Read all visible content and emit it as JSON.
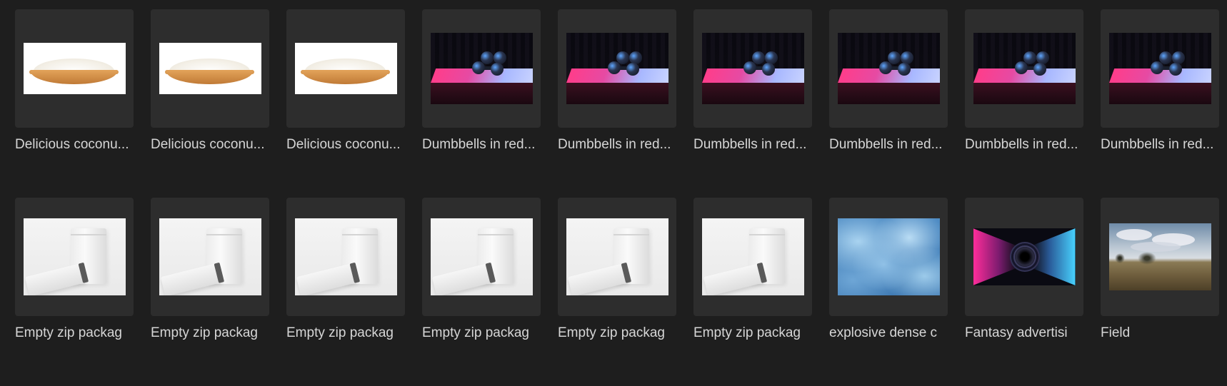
{
  "gallery": {
    "items": [
      {
        "label": "Delicious coconu...",
        "thumb": "coconut-pie"
      },
      {
        "label": "Delicious coconu...",
        "thumb": "coconut-pie"
      },
      {
        "label": "Delicious coconu...",
        "thumb": "coconut-pie"
      },
      {
        "label": "Dumbbells in red...",
        "thumb": "dumbbells"
      },
      {
        "label": "Dumbbells in red...",
        "thumb": "dumbbells"
      },
      {
        "label": "Dumbbells in red...",
        "thumb": "dumbbells"
      },
      {
        "label": "Dumbbells in red...",
        "thumb": "dumbbells"
      },
      {
        "label": "Dumbbells in red...",
        "thumb": "dumbbells"
      },
      {
        "label": "Dumbbells in red...",
        "thumb": "dumbbells"
      },
      {
        "label": "Empty zip packag",
        "thumb": "zip-package"
      },
      {
        "label": "Empty zip packag",
        "thumb": "zip-package"
      },
      {
        "label": "Empty zip packag",
        "thumb": "zip-package"
      },
      {
        "label": "Empty zip packag",
        "thumb": "zip-package"
      },
      {
        "label": "Empty zip packag",
        "thumb": "zip-package"
      },
      {
        "label": "Empty zip packag",
        "thumb": "zip-package"
      },
      {
        "label": "explosive dense c",
        "thumb": "clouds"
      },
      {
        "label": "Fantasy advertisi",
        "thumb": "neon-tunnel"
      },
      {
        "label": "Field",
        "thumb": "field"
      }
    ]
  },
  "colors": {
    "background": "#1e1e1e",
    "tile": "#2d2d2d",
    "label_text": "#d6d6d6"
  }
}
